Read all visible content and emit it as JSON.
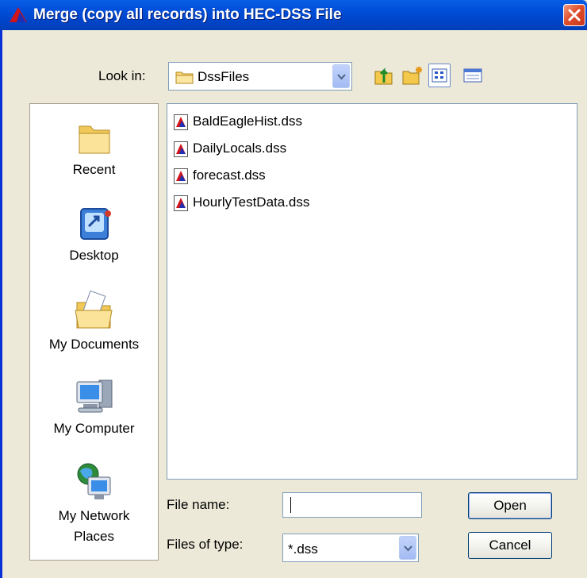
{
  "window": {
    "title": "Merge (copy all records) into HEC-DSS File",
    "app_icon": "hec-dss-icon",
    "close_icon": "close-icon"
  },
  "look_in": {
    "label": "Look in:",
    "accel": "i",
    "value": "DssFiles",
    "icon": "folder-icon"
  },
  "toolbar": {
    "icons": [
      "up-one-level-icon",
      "new-folder-icon",
      "list-view-icon",
      "details-view-icon"
    ]
  },
  "places": [
    {
      "label": "Recent",
      "icon": "recent-folder-icon"
    },
    {
      "label": "Desktop",
      "icon": "desktop-icon"
    },
    {
      "label": "My Documents",
      "icon": "my-documents-icon"
    },
    {
      "label": "My Computer",
      "icon": "my-computer-icon"
    },
    {
      "label": "My Network",
      "label2": "Places",
      "icon": "network-places-icon"
    }
  ],
  "files": [
    {
      "name": "BaldEagleHist.dss",
      "icon": "dss-file-icon"
    },
    {
      "name": "DailyLocals.dss",
      "icon": "dss-file-icon"
    },
    {
      "name": "forecast.dss",
      "icon": "dss-file-icon"
    },
    {
      "name": "HourlyTestData.dss",
      "icon": "dss-file-icon"
    }
  ],
  "file_name": {
    "label": "File name:",
    "value": ""
  },
  "file_type": {
    "label": "Files of type:",
    "value": "*.dss"
  },
  "buttons": {
    "open": "Open",
    "cancel": "Cancel"
  },
  "colors": {
    "titlebar": "#0050dc",
    "dialog_bg": "#ece9d8",
    "close_button": "#e1502d",
    "dss_icon": "#1f2fb4"
  }
}
